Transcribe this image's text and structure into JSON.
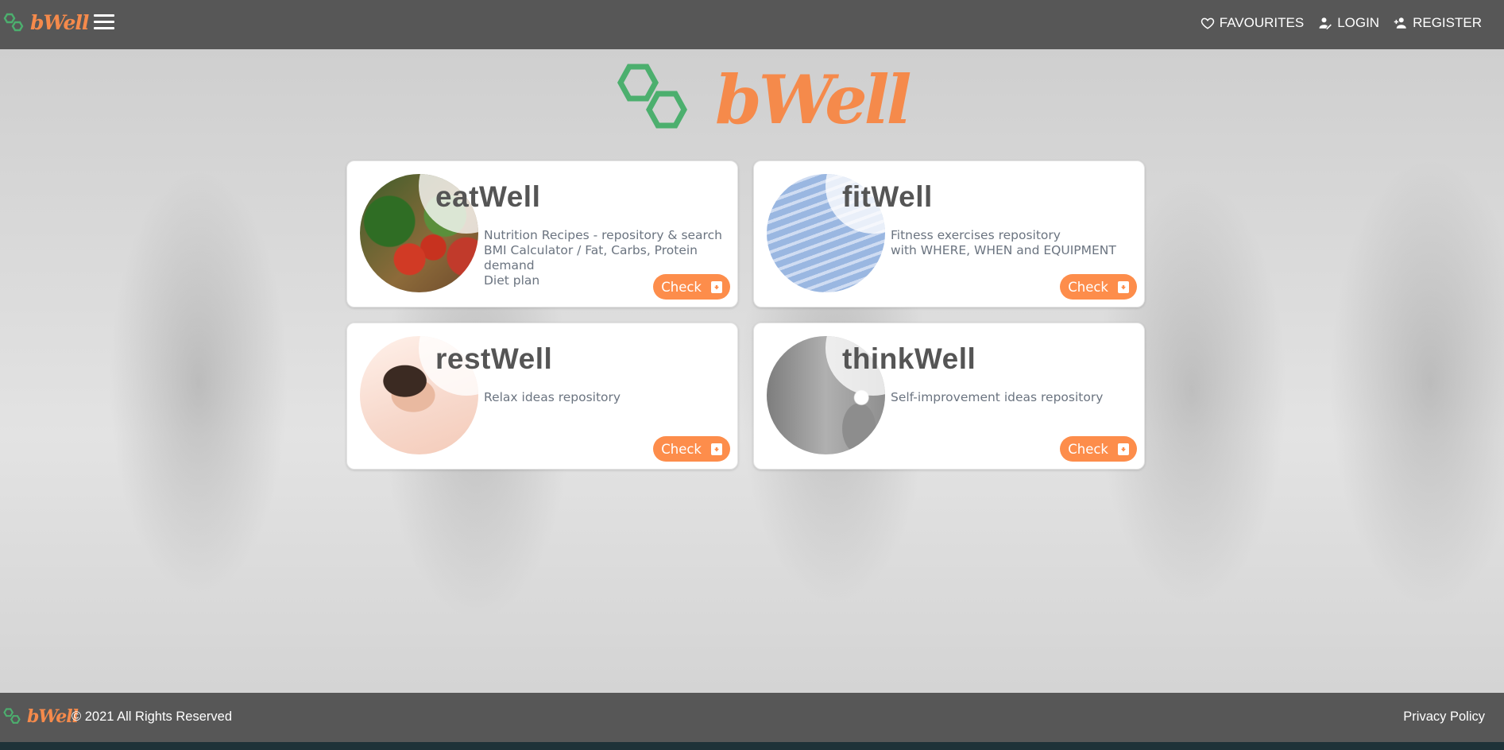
{
  "header": {
    "brand": "bWell",
    "nav": [
      {
        "label": "FAVOURITES",
        "icon": "heart-icon"
      },
      {
        "label": "LOGIN",
        "icon": "user-login-icon"
      },
      {
        "label": "REGISTER",
        "icon": "user-add-icon"
      }
    ]
  },
  "hero": {
    "brand": "bWell"
  },
  "cards": [
    {
      "title": "eatWell",
      "lines": [
        "Nutrition Recipes - repository & search",
        "BMI Calculator / Fat, Carbs, Protein demand",
        "Diet plan"
      ],
      "button": "Check"
    },
    {
      "title": "fitWell",
      "lines": [
        "Fitness exercises repository",
        "with WHERE, WHEN and EQUIPMENT"
      ],
      "button": "Check"
    },
    {
      "title": "restWell",
      "lines": [
        "Relax ideas repository"
      ],
      "button": "Check"
    },
    {
      "title": "thinkWell",
      "lines": [
        "Self-improvement ideas repository"
      ],
      "button": "Check"
    }
  ],
  "footer": {
    "brand": "bWell",
    "copyright": "© 2021 All Rights Reserved",
    "privacy": "Privacy Policy"
  },
  "colors": {
    "accent": "#fd8d4b",
    "logo_green": "#4caf6e",
    "bar": "#575757"
  }
}
